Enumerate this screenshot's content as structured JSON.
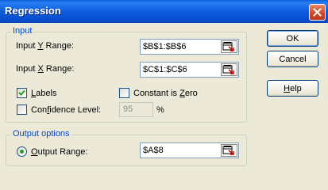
{
  "window": {
    "title": "Regression"
  },
  "input_group": {
    "title": "Input",
    "y_range": {
      "prefix": "Input ",
      "key": "Y",
      "suffix": " Range:",
      "value": "$B$1:$B$6"
    },
    "x_range": {
      "prefix": "Input ",
      "key": "X",
      "suffix": " Range:",
      "value": "$C$1:$C$6"
    },
    "labels": {
      "key": "L",
      "rest": "abels",
      "checked": true
    },
    "constant_zero": {
      "prefix": "Constant is ",
      "key": "Z",
      "suffix": "ero",
      "checked": false
    },
    "confidence": {
      "prefix": "Con",
      "key": "f",
      "suffix": "idence Level:",
      "checked": false,
      "value": "95",
      "unit": "%"
    }
  },
  "output_group": {
    "title": "Output options",
    "output_range": {
      "key": "O",
      "rest": "utput Range:",
      "selected": true,
      "value": "$A$8"
    }
  },
  "buttons": {
    "ok": "OK",
    "cancel": "Cancel",
    "help_key": "H",
    "help_rest": "elp"
  },
  "colors": {
    "title_bar": "#0a5fd8",
    "group_label": "#0046d5",
    "dialog_bg": "#ece9d8",
    "check": "#21a121"
  }
}
